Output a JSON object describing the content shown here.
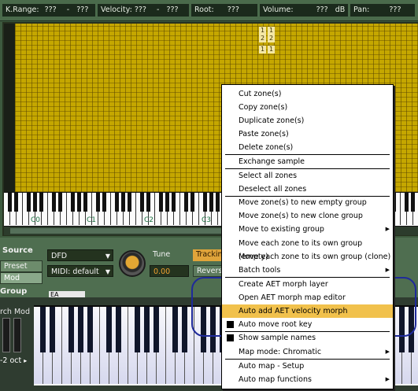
{
  "statusbar": {
    "krange_label": "K.Range:",
    "krange_lo": "???",
    "krange_sep": "-",
    "krange_hi": "???",
    "velocity_label": "Velocity:",
    "velocity_lo": "???",
    "velocity_sep": "-",
    "velocity_hi": "???",
    "root_label": "Root:",
    "root_value": "???",
    "volume_label": "Volume:",
    "volume_value": "???",
    "volume_unit": "dB",
    "pan_label": "Pan:",
    "pan_value": "???"
  },
  "zone_markers": [
    "1",
    "1",
    "2",
    "2",
    "1",
    "1"
  ],
  "keyboard": {
    "octave_labels": [
      "C0",
      "C1",
      "C2",
      "C3"
    ]
  },
  "panel": {
    "source_label": "Source",
    "preset_tab": "Preset",
    "mod_tab": "Mod",
    "group_label": "Group",
    "dfd_combo": "DFD",
    "midi_combo": "MIDI: default",
    "tune_label": "Tune",
    "tune_value": "0.00",
    "tracking_btn": "Tracking",
    "reverse_btn": "Revers",
    "group_field": "EA"
  },
  "bottom": {
    "pitch_mod_label": "rch Mod",
    "oct_label": "-2 oct",
    "oct_arrow": "▸"
  },
  "menu": {
    "items": [
      {
        "label": "Cut zone(s)"
      },
      {
        "label": "Copy zone(s)"
      },
      {
        "label": "Duplicate zone(s)"
      },
      {
        "label": "Paste zone(s)"
      },
      {
        "label": "Delete zone(s)"
      },
      {
        "label": "Exchange sample"
      },
      {
        "label": "Select all zones"
      },
      {
        "label": "Deselect all zones"
      },
      {
        "label": "Move zone(s) to new empty group"
      },
      {
        "label": "Move zone(s) to new clone group"
      },
      {
        "label": "Move to existing group"
      },
      {
        "label": "Move each zone to its own group (empty)"
      },
      {
        "label": "Move each zone to its own group (clone)"
      },
      {
        "label": "Batch tools"
      },
      {
        "label": "Create AET morph layer"
      },
      {
        "label": "Open AET morph map editor"
      },
      {
        "label": "Auto add AET velocity morph"
      },
      {
        "label": "Auto move root key"
      },
      {
        "label": "Show sample names"
      },
      {
        "label": "Map mode: Chromatic"
      },
      {
        "label": "Auto map - Setup"
      },
      {
        "label": "Auto map functions"
      }
    ],
    "submenu_arrow": "▶"
  },
  "colors": {
    "zone_fill": "#c5a700",
    "menu_highlight": "#f1c14c",
    "annotation_ring": "#1f2a9a",
    "panel_green": "#4f6e50"
  }
}
